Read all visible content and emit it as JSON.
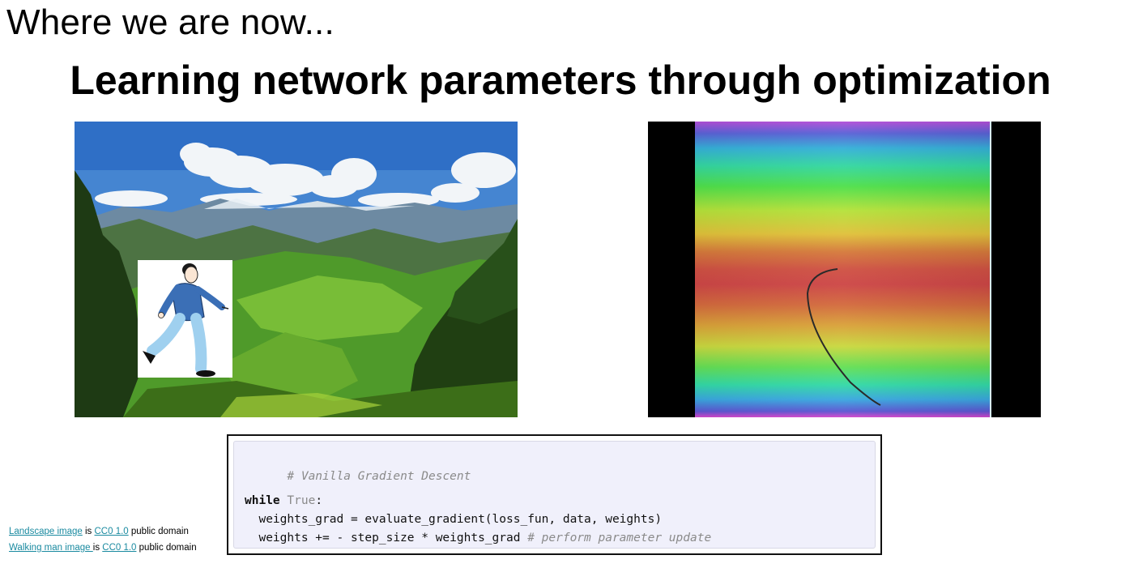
{
  "slide": {
    "kicker": "Where we are now...",
    "title": "Learning network parameters through optimization"
  },
  "images": {
    "landscape": {
      "icon": "mountain-landscape-photo"
    },
    "walker": {
      "icon": "walking-man-illustration"
    },
    "optimization": {
      "icon": "loss-surface-heatmap-with-descent-path"
    }
  },
  "code": {
    "comment": "# Vanilla Gradient Descent",
    "while_kw": "while",
    "while_cond": "True",
    "while_colon": ":",
    "line2": "  weights_grad = evaluate_gradient(loss_fun, data, weights)",
    "line3_code": "  weights += - step_size * weights_grad",
    "line3_comment": " # perform parameter update"
  },
  "credits": {
    "line1": {
      "link1": "Landscape image",
      "mid": " is ",
      "link2": "CC0 1.0",
      "tail": " public domain"
    },
    "line2": {
      "link1": "Walking man image ",
      "mid": "is ",
      "link2": "CC0 1.0",
      "tail": " public domain"
    }
  },
  "colors": {
    "link": "#1a8aa0",
    "code_bg": "#f0f0fb",
    "comment": "#8a8a8a"
  }
}
